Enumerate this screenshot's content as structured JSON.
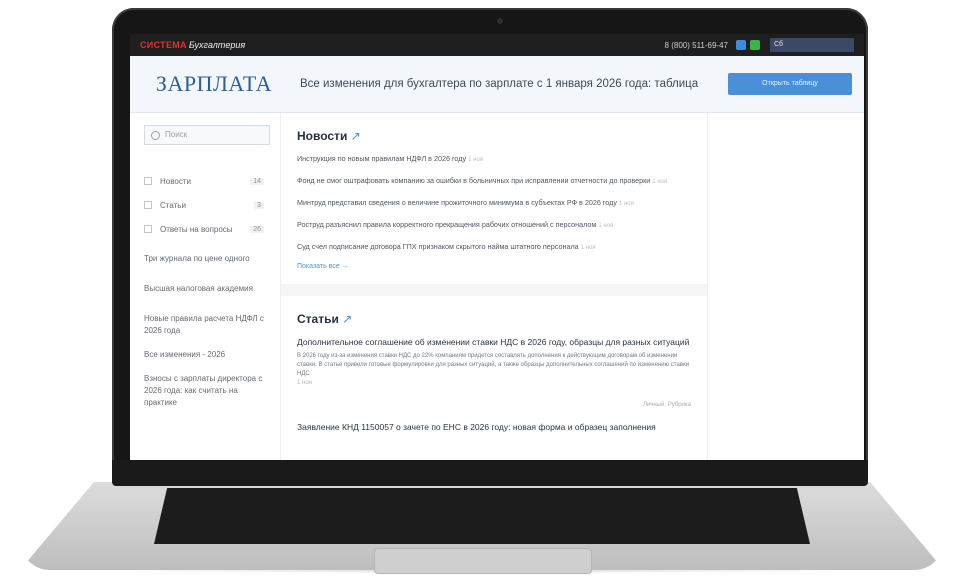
{
  "topbar": {
    "logo": "СИСТЕМА",
    "logo_sub": "Бухгалтерия",
    "phone": "8 (800) 511-69-47",
    "search_value": "Сб"
  },
  "header": {
    "brand": "ЗАРПЛАТА",
    "headline": "Все изменения для бухгалтера по зарплате с 1 января 2026 года: таблица",
    "cta": "Открыть таблицу"
  },
  "sidebar": {
    "search_placeholder": "Поиск",
    "items": [
      {
        "label": "Новости",
        "count": "14"
      },
      {
        "label": "Статьи",
        "count": "3"
      },
      {
        "label": "Ответы на вопросы",
        "count": "26"
      }
    ],
    "links": [
      "Три журнала по цене одного",
      "Высшая налоговая академия",
      "Новые правила расчета НДФЛ с 2026 года",
      "Все изменения - 2026",
      "Взносы с зарплаты директора с 2026 года: как считать на практике"
    ]
  },
  "news": {
    "title": "Новости",
    "arrow": "↗",
    "items": [
      {
        "text": "Инструкция по новым правилам НДФЛ в 2026 году",
        "date": "1 ноя"
      },
      {
        "text": "Фонд не смог оштрафовать компанию за ошибки в больничных при исправлении отчетности до проверки",
        "date": "1 ноя"
      },
      {
        "text": "Минтруд представил сведения о величине прожиточного минимума в субъектах РФ в 2026 году",
        "date": "1 ноя"
      },
      {
        "text": "Роструд разъяснил правила корректного прекращения рабочих отношений с персоналом",
        "date": "1 ноя"
      },
      {
        "text": "Суд счел подписание договора ГПХ признаком скрытого найма штатного персонала",
        "date": "1 ноя"
      }
    ],
    "more": "Показать все →"
  },
  "articles": {
    "title": "Статьи",
    "arrow": "↗",
    "first_title": "Дополнительное соглашение об изменении ставки НДС в 2026 году, образцы для разных ситуаций",
    "first_text": "В 2026 году из-за изменения ставки НДС до 22% компаниям придется составлять дополнения к действующим договорам об изменении ставки. В статье привели готовые формулировки для разных ситуаций, а также образцы дополнительных соглашений по изменению ставки НДС",
    "first_date": "1 ноя",
    "first_meta": "Личный, Рубрика",
    "second_title": "Заявление КНД 1150057 о зачете по ЕНС в 2026 году: новая форма и образец заполнения"
  }
}
